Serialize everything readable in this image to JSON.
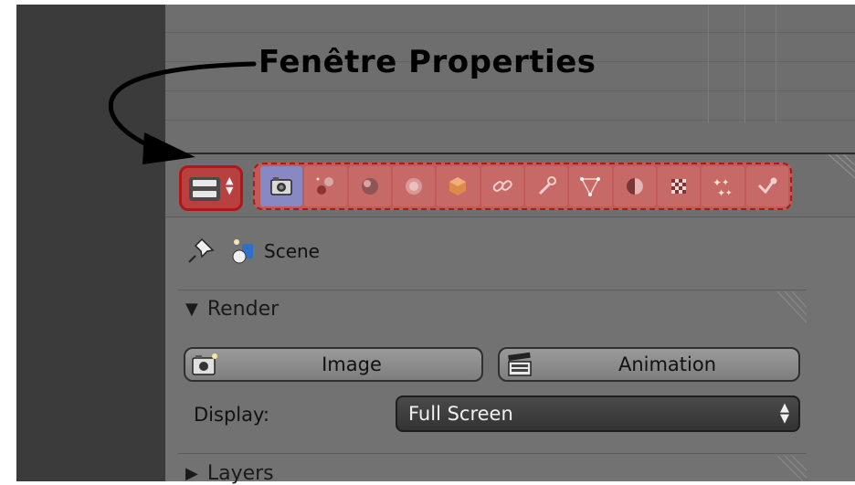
{
  "annotation": {
    "title": "Fenêtre Properties"
  },
  "properties": {
    "editor_type_icon": "properties-editor-icon",
    "context_tabs": [
      {
        "name": "render",
        "icon": "camera-icon",
        "active": true
      },
      {
        "name": "render-layers",
        "icon": "render-layers-icon",
        "active": false
      },
      {
        "name": "scene",
        "icon": "scene-icon",
        "active": false
      },
      {
        "name": "world",
        "icon": "world-icon",
        "active": false
      },
      {
        "name": "object",
        "icon": "cube-icon",
        "active": false
      },
      {
        "name": "constraints",
        "icon": "chain-link-icon",
        "active": false
      },
      {
        "name": "modifiers",
        "icon": "wrench-icon",
        "active": false
      },
      {
        "name": "data",
        "icon": "mesh-triangle-icon",
        "active": false
      },
      {
        "name": "material",
        "icon": "sphere-icon",
        "active": false
      },
      {
        "name": "texture",
        "icon": "checker-icon",
        "active": false
      },
      {
        "name": "particles",
        "icon": "particles-icon",
        "active": false
      },
      {
        "name": "physics",
        "icon": "physics-icon",
        "active": false
      }
    ],
    "breadcrumb": {
      "label": "Scene"
    },
    "render_panel": {
      "title": "Render",
      "image_button": "Image",
      "animation_button": "Animation",
      "display_label": "Display:",
      "display_value": "Full Screen"
    },
    "layers_panel": {
      "title": "Layers"
    }
  },
  "colors": {
    "highlight_red": "#b01818",
    "active_tab": "#8888c4",
    "panel_bg": "#727272"
  }
}
